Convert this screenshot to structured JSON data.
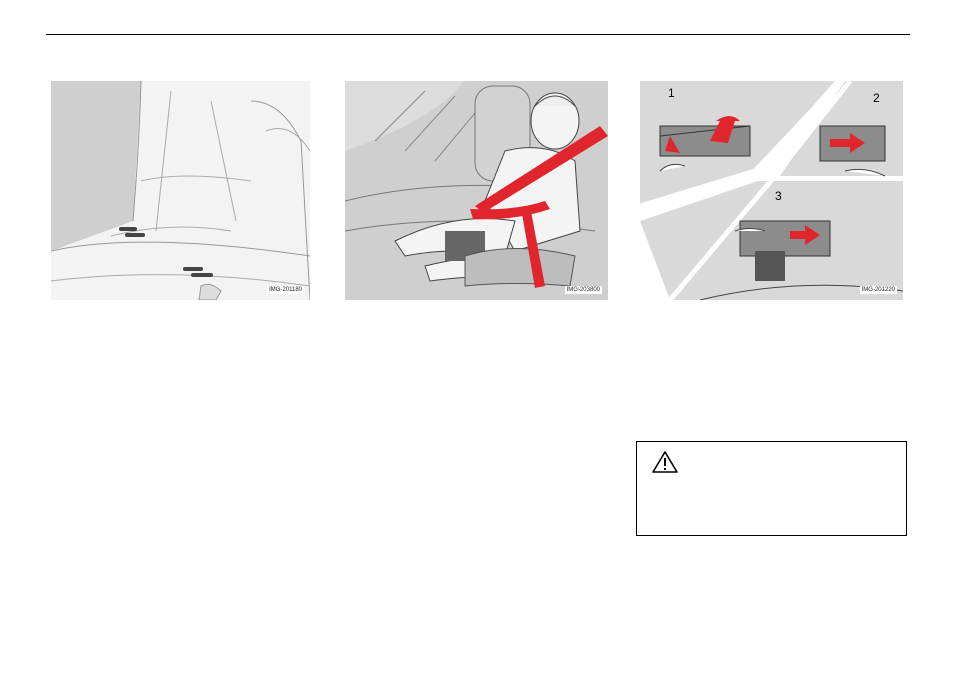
{
  "figures": [
    {
      "label": "IMG-201180"
    },
    {
      "label": "IMG-203800"
    },
    {
      "label": "IMG-201220",
      "steps": [
        "1",
        "2",
        "3"
      ]
    }
  ],
  "warning": {
    "icon": "warning-triangle-icon"
  },
  "colors": {
    "accent_red": "#e0262c",
    "panel_gray": "#d9d9d9"
  }
}
